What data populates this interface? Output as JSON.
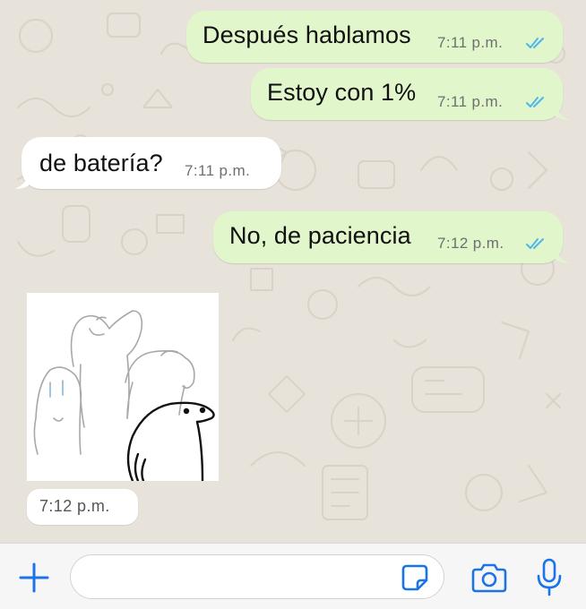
{
  "colors": {
    "outgoing_bubble": "#e1f7cb",
    "incoming_bubble": "#ffffff",
    "chat_background": "#e8e3da",
    "read_ticks": "#4fb6ec",
    "accent_icons": "#1a73e8"
  },
  "messages": [
    {
      "direction": "outgoing",
      "text": "Después hablamos",
      "time": "7:11 p.m.",
      "status": "read"
    },
    {
      "direction": "outgoing",
      "text": "Estoy con 1%",
      "time": "7:11 p.m.",
      "status": "read"
    },
    {
      "direction": "incoming",
      "text": "de batería?",
      "time": "7:11 p.m."
    },
    {
      "direction": "outgoing",
      "text": "No, de paciencia",
      "time": "7:12 p.m.",
      "status": "read"
    },
    {
      "direction": "incoming",
      "type": "sticker",
      "time": "7:12 p.m."
    }
  ],
  "composer": {
    "icons": [
      "plus-icon",
      "sticker-icon",
      "camera-icon",
      "microphone-icon"
    ],
    "input_value": ""
  }
}
